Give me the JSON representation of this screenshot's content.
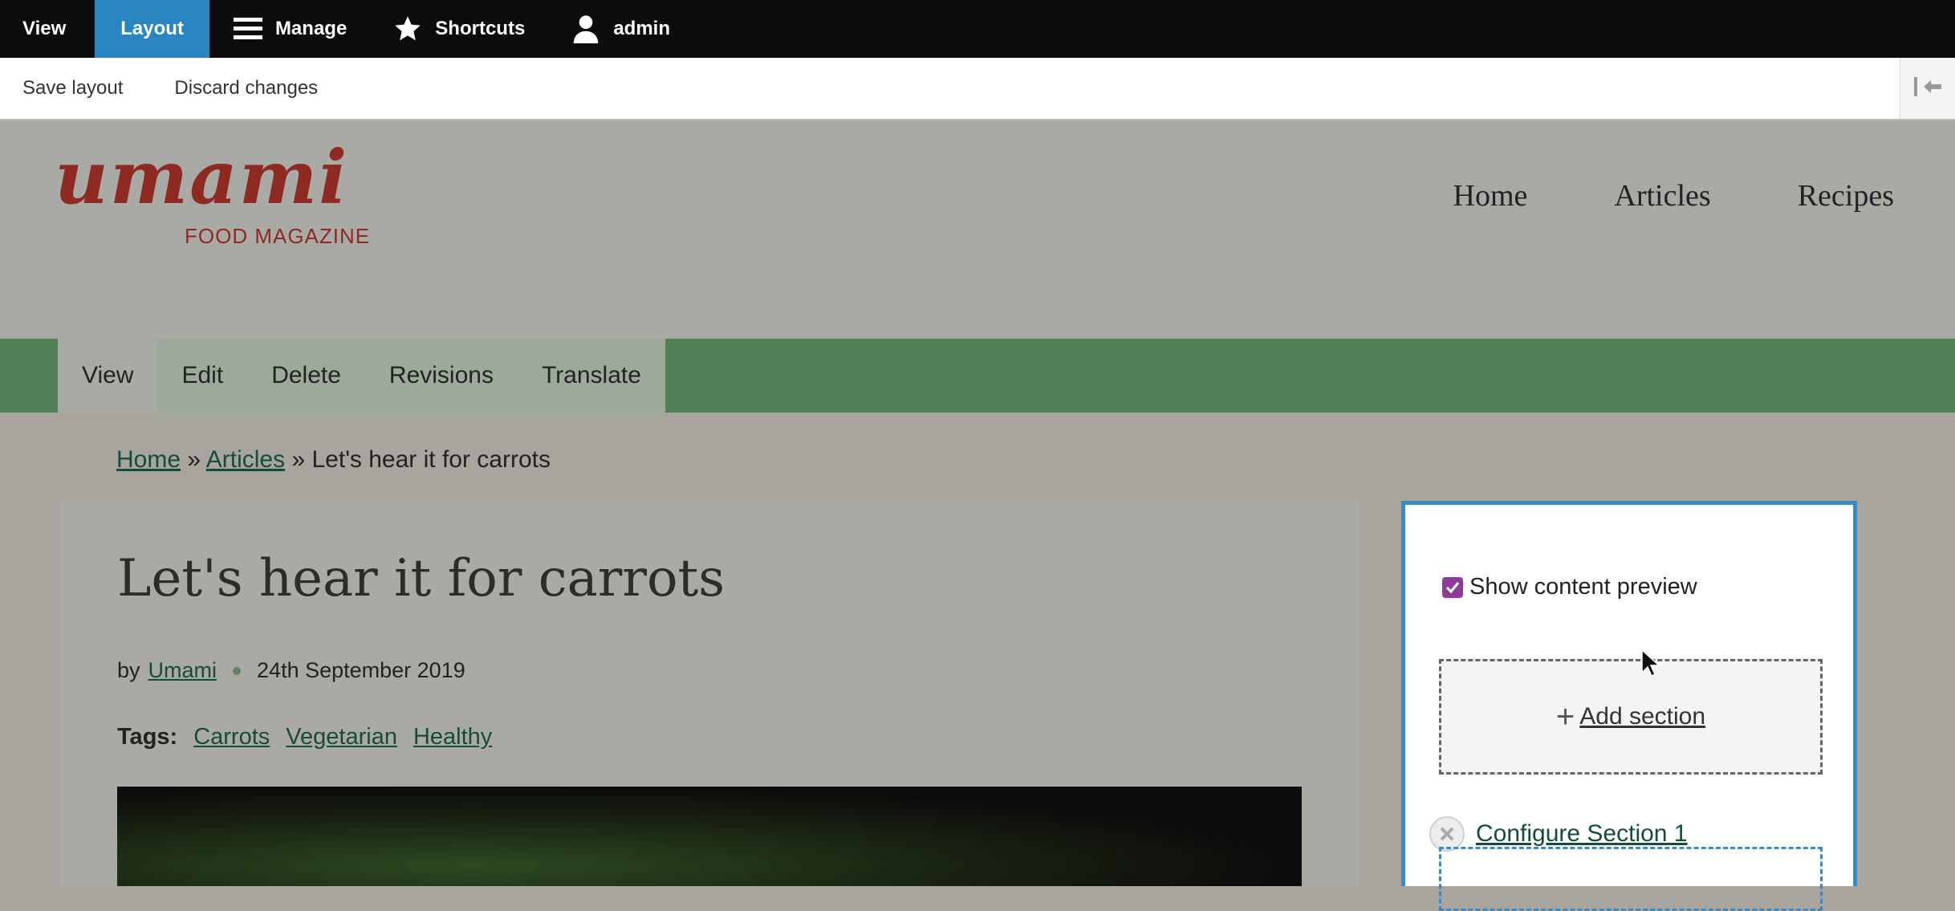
{
  "toolbar": {
    "items": [
      {
        "label": "View",
        "icon": "",
        "active": false
      },
      {
        "label": "Layout",
        "icon": "",
        "active": true
      },
      {
        "label": "Manage",
        "icon": "hamburger-icon",
        "active": false
      },
      {
        "label": "Shortcuts",
        "icon": "star-icon",
        "active": false
      },
      {
        "label": "admin",
        "icon": "user-icon",
        "active": false
      }
    ],
    "accent_color": "#2a86c3"
  },
  "tray": {
    "save_label": "Save layout",
    "discard_label": "Discard changes",
    "toggle_icon": "collapse-left-icon"
  },
  "site": {
    "logo_word": "umami",
    "logo_sub": "FOOD MAGAZINE",
    "logo_color": "#8e2a22",
    "nav": [
      "Home",
      "Articles",
      "Recipes"
    ]
  },
  "tasks": [
    "View",
    "Edit",
    "Delete",
    "Revisions",
    "Translate"
  ],
  "breadcrumb": {
    "home": "Home",
    "separator": "»",
    "articles": "Articles",
    "current": "Let's hear it for carrots"
  },
  "article": {
    "title": "Let's hear it for carrots",
    "by": "by",
    "author": "Umami",
    "date": "24th September 2019",
    "tags_label": "Tags:",
    "tags": [
      "Carrots",
      "Vegetarian",
      "Healthy"
    ]
  },
  "layout_builder": {
    "show_preview_label": "Show content preview",
    "show_preview_checked": true,
    "add_section_label": "Add section",
    "configure_section_label": "Configure Section 1",
    "panel_border_color": "#3a8ac6",
    "checkbox_color": "#8e3d96"
  }
}
